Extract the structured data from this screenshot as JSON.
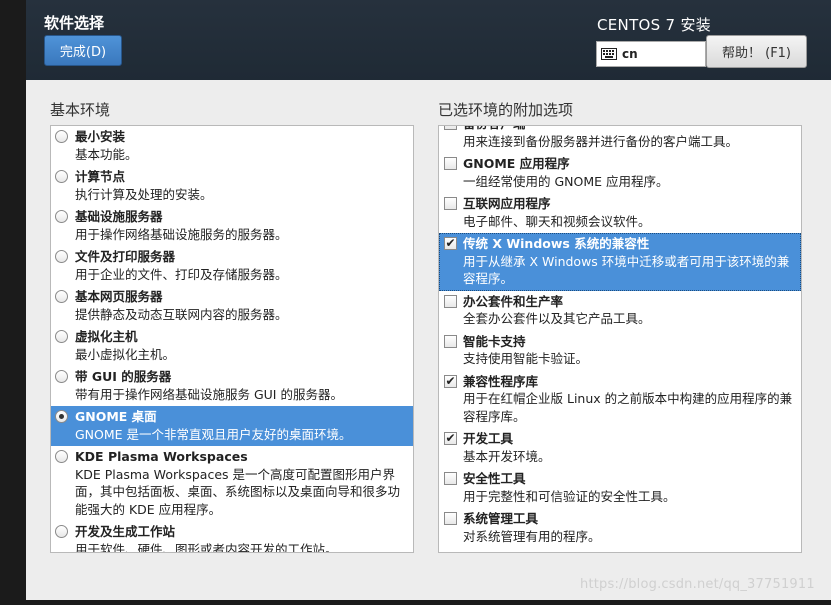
{
  "header": {
    "title": "软件选择",
    "done_label": "完成(D)",
    "install_title": "CENTOS 7 安装",
    "keyboard_layout": "cn",
    "help_label": "帮助！ (F1)"
  },
  "environments": {
    "title": "基本环境",
    "items": [
      {
        "name": "最小安装",
        "desc": "基本功能。",
        "selected": false
      },
      {
        "name": "计算节点",
        "desc": "执行计算及处理的安装。",
        "selected": false
      },
      {
        "name": "基础设施服务器",
        "desc": "用于操作网络基础设施服务的服务器。",
        "selected": false
      },
      {
        "name": "文件及打印服务器",
        "desc": "用于企业的文件、打印及存储服务器。",
        "selected": false
      },
      {
        "name": "基本网页服务器",
        "desc": "提供静态及动态互联网内容的服务器。",
        "selected": false
      },
      {
        "name": "虚拟化主机",
        "desc": "最小虚拟化主机。",
        "selected": false
      },
      {
        "name": "带 GUI 的服务器",
        "desc": "带有用于操作网络基础设施服务 GUI 的服务器。",
        "selected": false
      },
      {
        "name": "GNOME 桌面",
        "desc": "GNOME 是一个非常直观且用户友好的桌面环境。",
        "selected": true
      },
      {
        "name": "KDE Plasma Workspaces",
        "desc": "KDE Plasma Workspaces 是一个高度可配置图形用户界面，其中包括面板、桌面、系统图标以及桌面向导和很多功能强大的 KDE 应用程序。",
        "selected": false
      },
      {
        "name": "开发及生成工作站",
        "desc": "用于软件、硬件、图形或者内容开发的工作站。",
        "selected": false
      }
    ]
  },
  "addons": {
    "title": "已选环境的附加选项",
    "items": [
      {
        "name": "备份客户端",
        "desc": "用来连接到备份服务器并进行备份的客户端工具。",
        "checked": false,
        "highlighted": false
      },
      {
        "name": "GNOME 应用程序",
        "desc": "一组经常使用的 GNOME 应用程序。",
        "checked": false,
        "highlighted": false
      },
      {
        "name": "互联网应用程序",
        "desc": "电子邮件、聊天和视频会议软件。",
        "checked": false,
        "highlighted": false
      },
      {
        "name": "传统 X Windows 系统的兼容性",
        "desc": "用于从继承 X Windows 环境中迁移或者可用于该环境的兼容程序。",
        "checked": true,
        "highlighted": true
      },
      {
        "name": "办公套件和生产率",
        "desc": "全套办公套件以及其它产品工具。",
        "checked": false,
        "highlighted": false
      },
      {
        "name": "智能卡支持",
        "desc": "支持使用智能卡验证。",
        "checked": false,
        "highlighted": false
      },
      {
        "name": "兼容性程序库",
        "desc": "用于在红帽企业版 Linux 的之前版本中构建的应用程序的兼容程序库。",
        "checked": true,
        "highlighted": false
      },
      {
        "name": "开发工具",
        "desc": "基本开发环境。",
        "checked": true,
        "highlighted": false
      },
      {
        "name": "安全性工具",
        "desc": "用于完整性和可信验证的安全性工具。",
        "checked": false,
        "highlighted": false
      },
      {
        "name": "系统管理工具",
        "desc": "对系统管理有用的程序。",
        "checked": false,
        "highlighted": false
      }
    ]
  },
  "watermark": "https://blog.csdn.net/qq_37751911",
  "colors": {
    "header_bg": "#23303c",
    "accent": "#4a90d9",
    "content_bg": "#ededed"
  },
  "icons": {
    "keyboard": "keyboard-icon"
  }
}
